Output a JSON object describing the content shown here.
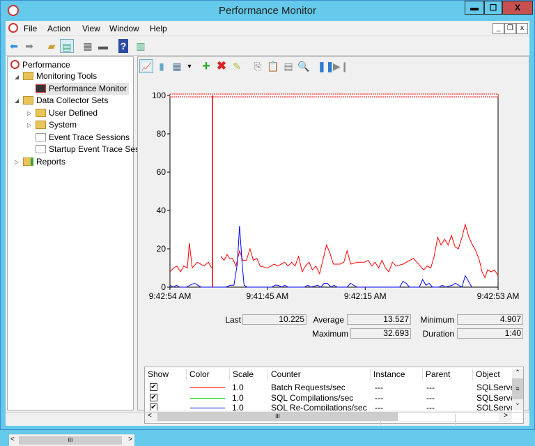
{
  "window": {
    "title": "Performance Monitor",
    "minimize": "▬",
    "maximize": "☐",
    "close": "X"
  },
  "menu": [
    "File",
    "Action",
    "View",
    "Window",
    "Help"
  ],
  "tree": [
    {
      "label": "Performance"
    },
    {
      "label": "Monitoring Tools"
    },
    {
      "label": "Performance Monitor"
    },
    {
      "label": "Data Collector Sets"
    },
    {
      "label": "User Defined"
    },
    {
      "label": "System"
    },
    {
      "label": "Event Trace Sessions"
    },
    {
      "label": "Startup Event Trace Ses"
    },
    {
      "label": "Reports"
    }
  ],
  "stats": {
    "last_label": "Last",
    "last": "10.225",
    "average_label": "Average",
    "average": "13.527",
    "minimum_label": "Minimum",
    "minimum": "4.907",
    "maximum_label": "Maximum",
    "maximum": "32.693",
    "duration_label": "Duration",
    "duration": "1:40"
  },
  "table": {
    "headers": [
      "Show",
      "Color",
      "Scale",
      "Counter",
      "Instance",
      "Parent",
      "Object"
    ],
    "rows": [
      {
        "color": "#ff0000",
        "scale": "1.0",
        "counter": "Batch Requests/sec",
        "instance": "---",
        "parent": "---",
        "object": "SQLServe"
      },
      {
        "color": "#00e000",
        "scale": "1.0",
        "counter": "SQL Compilations/sec",
        "instance": "---",
        "parent": "---",
        "object": "SQLServe"
      },
      {
        "color": "#0000cc",
        "scale": "1.0",
        "counter": "SQL Re-Compilations/sec",
        "instance": "---",
        "parent": "---",
        "object": "SQLServe"
      }
    ]
  },
  "chart_data": {
    "type": "line",
    "y_ticks": [
      "0",
      "20",
      "40",
      "60",
      "80",
      "100"
    ],
    "ylim": [
      0,
      100
    ],
    "xlim": [
      0,
      100
    ],
    "x_tick_labels": [
      {
        "at": 0,
        "label": "9:42:54 AM"
      },
      {
        "at": 29.7,
        "label": "9:41:45 AM"
      },
      {
        "at": 59.5,
        "label": "9:42:15 AM"
      },
      {
        "at": 100,
        "label": "9:42:53 AM"
      }
    ],
    "current_marker": 13.0,
    "series": [
      {
        "name": "Batch Requests/sec",
        "color": "#ff0000",
        "points": [
          [
            0,
            8
          ],
          [
            1.1,
            10
          ],
          [
            2.1,
            11
          ],
          [
            3.2,
            8
          ],
          [
            4.2,
            11
          ],
          [
            5.3,
            10
          ],
          [
            5.9,
            23
          ],
          [
            6.8,
            10
          ],
          [
            8.3,
            13
          ],
          [
            10.4,
            11
          ],
          [
            11.7,
            13
          ],
          [
            12.7,
            10
          ],
          null,
          [
            15.5,
            16
          ],
          [
            16.5,
            14
          ],
          [
            17.4,
            17
          ],
          [
            18.2,
            15
          ],
          [
            19.1,
            15
          ],
          [
            20.1,
            11
          ],
          [
            21.2,
            19
          ],
          [
            22.2,
            14
          ],
          [
            23.3,
            14
          ],
          [
            24.4,
            20
          ],
          [
            25.4,
            14
          ],
          [
            26.5,
            15
          ],
          [
            27.5,
            11
          ],
          [
            29.7,
            10
          ],
          [
            31.8,
            12
          ],
          [
            32.8,
            11
          ],
          [
            35,
            13
          ],
          [
            36,
            11
          ],
          [
            37.1,
            13
          ],
          [
            38.1,
            11
          ],
          [
            39.2,
            16
          ],
          [
            40.3,
            8
          ],
          [
            41.3,
            11
          ],
          [
            42.4,
            13
          ],
          [
            43.4,
            9
          ],
          [
            44.5,
            11
          ],
          [
            45.6,
            7
          ],
          [
            46.6,
            14
          ],
          [
            47.7,
            22
          ],
          [
            48.7,
            18
          ],
          [
            49.8,
            12
          ],
          [
            51.9,
            12
          ],
          [
            53,
            13
          ],
          [
            54,
            19
          ],
          [
            55.1,
            12
          ],
          [
            57.2,
            13
          ],
          [
            59.3,
            13
          ],
          [
            60.4,
            14
          ],
          [
            61.5,
            11
          ],
          [
            62.5,
            13
          ],
          [
            63.6,
            10
          ],
          [
            64.6,
            14
          ],
          [
            65.7,
            10
          ],
          [
            66.7,
            8
          ],
          [
            67.8,
            13
          ],
          [
            68.9,
            11
          ],
          [
            71,
            12
          ],
          [
            74.2,
            15
          ],
          [
            76.3,
            11
          ],
          [
            77.3,
            9
          ],
          [
            78.4,
            11
          ],
          [
            79.5,
            10
          ],
          [
            80.5,
            16
          ],
          [
            81.6,
            26
          ],
          [
            82.6,
            22
          ],
          [
            83.7,
            25
          ],
          [
            84.8,
            22
          ],
          [
            85.8,
            27
          ],
          [
            86.9,
            21
          ],
          [
            87.9,
            20
          ],
          [
            89,
            26
          ],
          [
            90,
            32.7
          ],
          [
            91.1,
            26
          ],
          [
            92.2,
            22
          ],
          [
            93.2,
            19
          ],
          [
            94.3,
            14
          ],
          [
            95.1,
            8
          ],
          [
            96,
            4.9
          ],
          [
            96.8,
            9
          ],
          [
            97.9,
            8
          ],
          [
            98.9,
            9
          ],
          [
            100,
            6
          ]
        ]
      },
      {
        "name": "SQL Re-Compilations/sec",
        "color": "#0000ff",
        "points": [
          [
            0,
            1
          ],
          [
            1,
            0
          ],
          [
            2,
            1
          ],
          [
            3,
            0
          ],
          [
            5,
            0
          ],
          [
            6,
            1
          ],
          [
            7.5,
            2
          ],
          [
            8.5,
            1
          ],
          [
            9.5,
            0
          ],
          [
            12.5,
            0
          ],
          [
            17,
            0
          ],
          [
            18.5,
            1
          ],
          [
            19.5,
            1
          ],
          [
            20.5,
            12
          ],
          [
            21.2,
            32
          ],
          [
            22,
            12
          ],
          [
            22.6,
            1
          ],
          [
            23.5,
            0
          ],
          [
            31,
            0
          ],
          [
            32,
            1
          ],
          [
            33,
            1
          ],
          [
            34,
            0
          ],
          [
            35,
            1
          ],
          [
            36,
            0
          ],
          [
            41,
            0
          ],
          [
            42,
            1
          ],
          [
            43,
            0
          ],
          [
            45,
            1
          ],
          [
            46,
            0
          ],
          [
            47,
            2
          ],
          [
            48,
            2
          ],
          [
            49,
            0
          ],
          [
            50,
            1
          ],
          [
            51,
            0
          ],
          [
            54,
            0
          ],
          [
            55,
            2
          ],
          [
            56,
            1
          ],
          [
            57,
            0
          ],
          [
            70,
            0
          ],
          [
            71,
            3
          ],
          [
            72,
            2
          ],
          [
            73,
            0
          ],
          [
            76,
            0
          ],
          [
            77,
            4
          ],
          [
            78,
            1
          ],
          [
            79,
            2
          ],
          [
            80,
            0
          ],
          [
            82,
            0
          ],
          [
            83,
            1
          ],
          [
            84,
            0
          ],
          [
            86,
            1
          ],
          [
            87,
            2
          ],
          [
            88,
            1
          ],
          [
            89,
            0
          ],
          [
            90,
            6
          ],
          [
            91,
            3
          ],
          [
            92,
            0
          ]
        ]
      }
    ]
  }
}
